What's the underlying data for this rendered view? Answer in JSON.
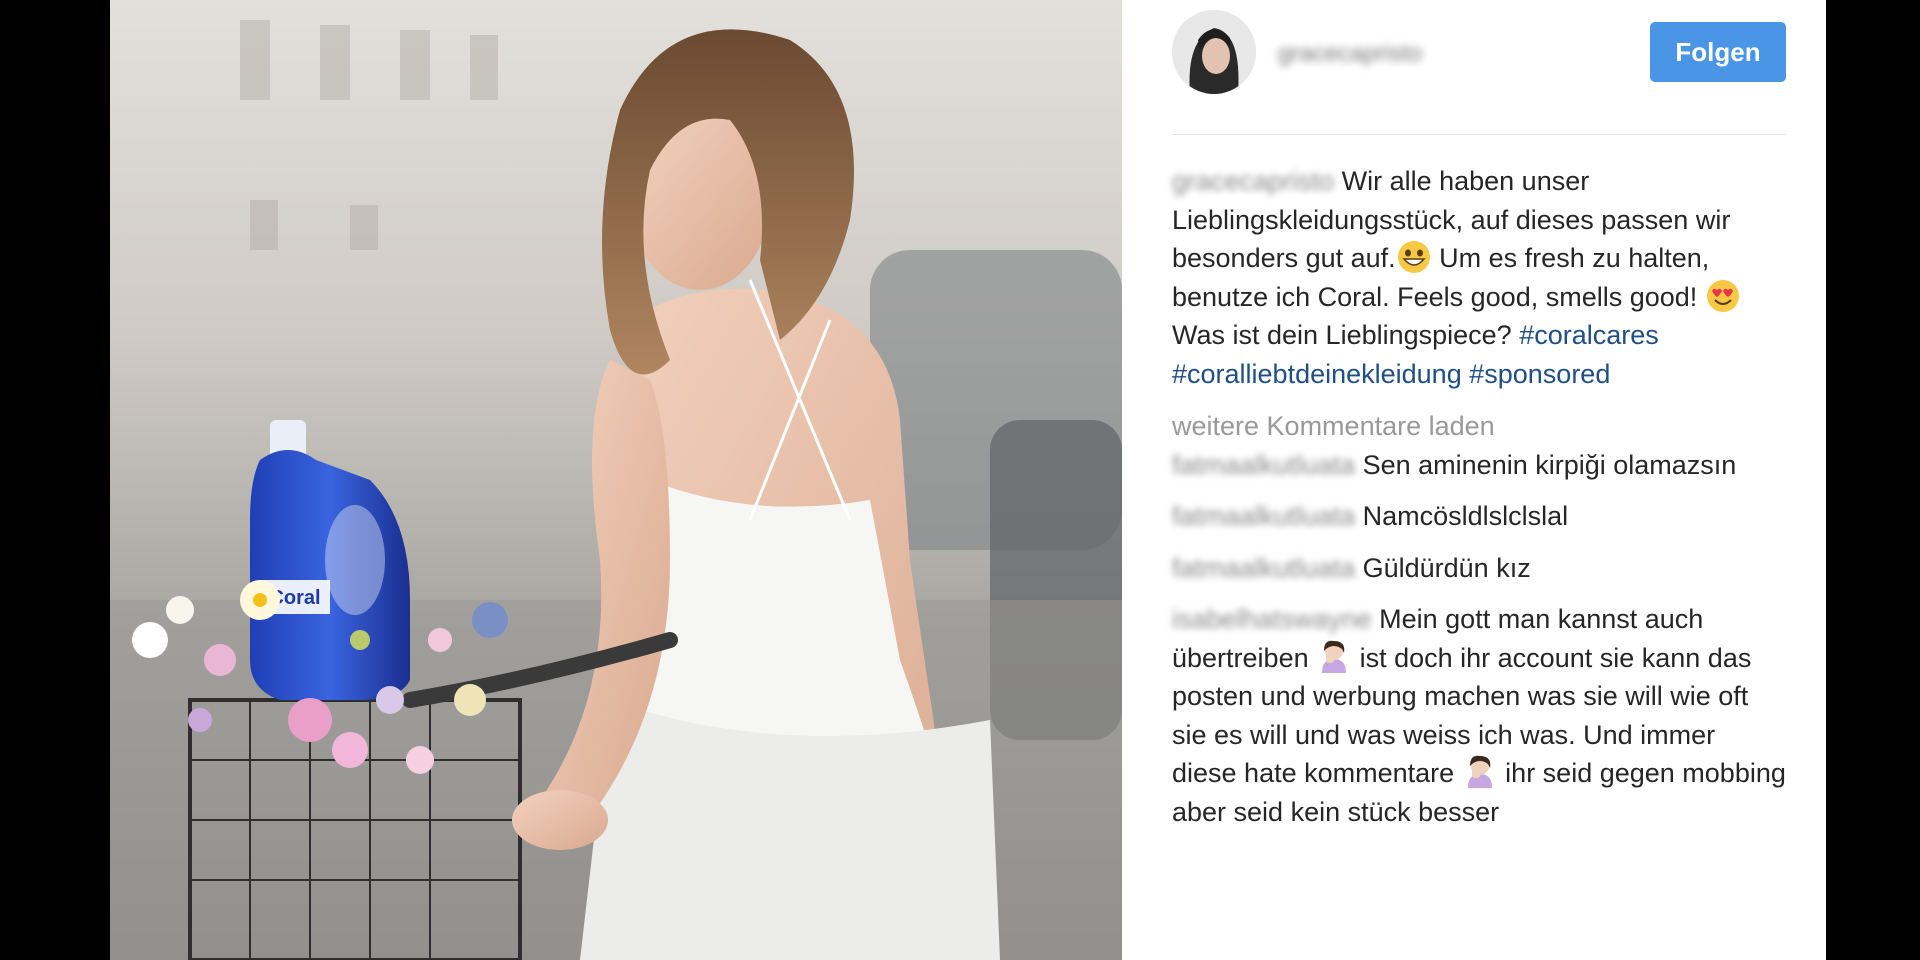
{
  "post": {
    "follow_label": "Folgen",
    "username": "gracecapristo",
    "caption": {
      "author": "gracecapristo",
      "text_1": " Wir alle haben unser Lieblingskleidungsstück, auf dieses passen wir besonders gut auf.",
      "text_2": " Um es fresh zu halten, benutze ich Coral. Feels good, smells good! ",
      "text_3": " Was ist dein Lieblingspiece? ",
      "hashtag_1": "#coralcares",
      "hashtag_2": "#coralliebtdeinekleidung",
      "hashtag_3": "#sponsored"
    },
    "load_more": "weitere Kommentare laden",
    "comments": [
      {
        "author": "fatmaalkutluata",
        "text": " Sen aminenin kirpiği olamazsın"
      },
      {
        "author": "fatmaalkutluata",
        "text": " Namcösldlslclslal"
      },
      {
        "author": "fatmaalkutluata",
        "text": " Güldürdün kız"
      },
      {
        "author": "isabelhatswayne",
        "text_1": " Mein gott man kannst auch übertreiben ",
        "text_2": " ist doch ihr account sie kann das posten und werbung machen was sie will wie oft sie es will und was weiss ich was. Und immer diese hate kommentare ",
        "text_3": " ihr seid gegen mobbing aber seid kein stück besser"
      }
    ]
  },
  "image": {
    "bottle_label": "Coral"
  },
  "colors": {
    "follow_button": "#4a95e6",
    "hashtag": "#1f4f86"
  }
}
